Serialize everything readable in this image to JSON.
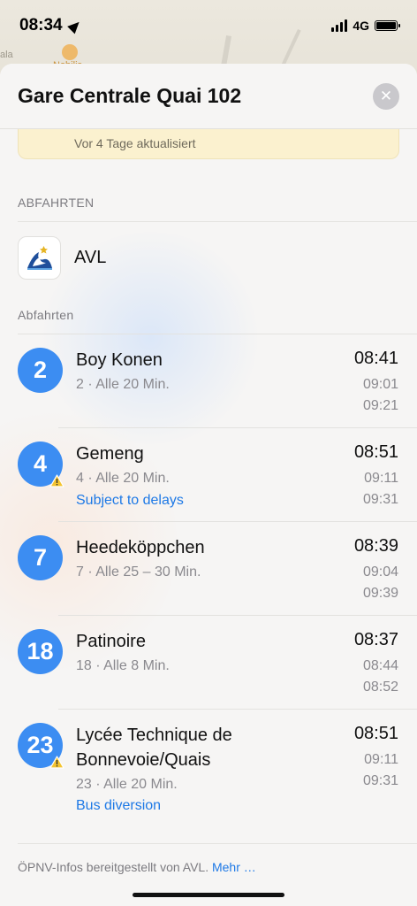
{
  "status_bar": {
    "time": "08:34",
    "network": "4G"
  },
  "map": {
    "label_left": "ala",
    "label_place": "Nobilis"
  },
  "sheet": {
    "title": "Gare Centrale Quai 102",
    "notice": "Vor 4 Tage aktualisiert",
    "section_departures": "ABFAHRTEN",
    "agency_name": "AVL",
    "subsection_departures": "Abfahrten",
    "footer_text": "ÖPNV-Infos bereitgestellt von AVL.",
    "footer_link": "Mehr …"
  },
  "departures": [
    {
      "route": "2",
      "destination": "Boy Konen",
      "meta": "2 · Alle 20 Min.",
      "alert": "",
      "times": [
        "08:41",
        "09:01",
        "09:21"
      ]
    },
    {
      "route": "4",
      "destination": "Gemeng",
      "meta": "4 · Alle 20 Min.",
      "alert": "Subject to delays",
      "times": [
        "08:51",
        "09:11",
        "09:31"
      ]
    },
    {
      "route": "7",
      "destination": "Heedeköppchen",
      "meta": "7 · Alle 25 – 30 Min.",
      "alert": "",
      "times": [
        "08:39",
        "09:04",
        "09:39"
      ]
    },
    {
      "route": "18",
      "destination": "Patinoire",
      "meta": "18 · Alle 8 Min.",
      "alert": "",
      "times": [
        "08:37",
        "08:44",
        "08:52"
      ]
    },
    {
      "route": "23",
      "destination_line1": "Lycée Technique de",
      "destination_line2": "Bonnevoie/Quais",
      "meta": "23 · Alle 20 Min.",
      "alert": "Bus diversion",
      "times": [
        "08:51",
        "09:11",
        "09:31"
      ]
    }
  ],
  "colors": {
    "route_badge": "#3c8df2",
    "link": "#1e79e6",
    "notice_bg": "#fbf1cf"
  }
}
